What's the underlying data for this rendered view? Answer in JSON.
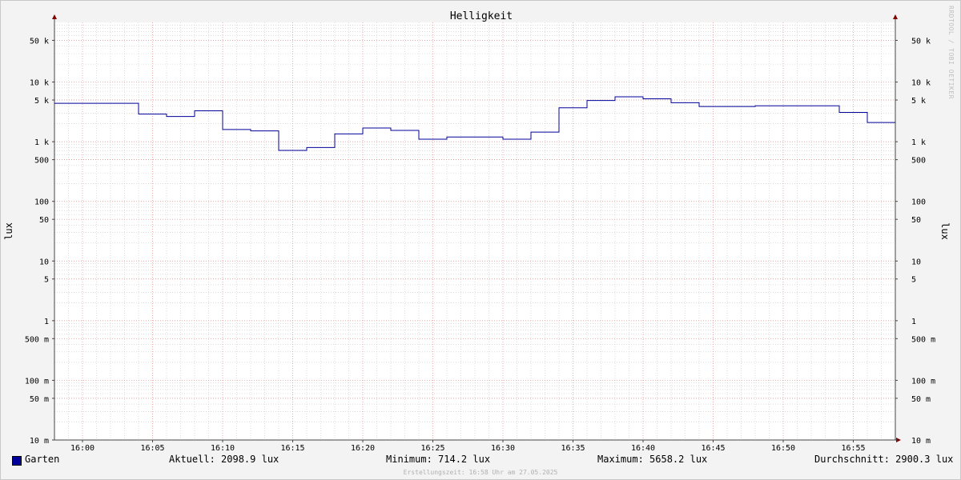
{
  "chart_data": {
    "type": "line",
    "line_style": "step",
    "title": "Helligkeit",
    "ylabel": "lux",
    "y_scale": "log",
    "ylim": [
      0.01,
      100000
    ],
    "y_ticks": [
      {
        "value": 0.01,
        "label": "10 m"
      },
      {
        "value": 0.05,
        "label": "50 m"
      },
      {
        "value": 0.1,
        "label": "100 m"
      },
      {
        "value": 0.5,
        "label": "500 m"
      },
      {
        "value": 1,
        "label": "1"
      },
      {
        "value": 5,
        "label": "5"
      },
      {
        "value": 10,
        "label": "10"
      },
      {
        "value": 50,
        "label": "50"
      },
      {
        "value": 100,
        "label": "100"
      },
      {
        "value": 500,
        "label": "500"
      },
      {
        "value": 1000,
        "label": "1 k"
      },
      {
        "value": 5000,
        "label": "5 k"
      },
      {
        "value": 10000,
        "label": "10 k"
      },
      {
        "value": 50000,
        "label": "50 k"
      }
    ],
    "xlim": [
      "15:58",
      "16:58"
    ],
    "x_ticks": [
      "16:00",
      "16:05",
      "16:10",
      "16:15",
      "16:20",
      "16:25",
      "16:30",
      "16:35",
      "16:40",
      "16:45",
      "16:50",
      "16:55"
    ],
    "grid": true,
    "series": [
      {
        "name": "Garten",
        "color": "#000099",
        "x": [
          "15:58",
          "16:04",
          "16:06",
          "16:08",
          "16:10",
          "16:12",
          "16:14",
          "16:16",
          "16:18",
          "16:20",
          "16:22",
          "16:24",
          "16:26",
          "16:28",
          "16:30",
          "16:32",
          "16:34",
          "16:36",
          "16:38",
          "16:40",
          "16:42",
          "16:44",
          "16:46",
          "16:48",
          "16:50",
          "16:52",
          "16:54",
          "16:56",
          "16:58"
        ],
        "y": [
          4400,
          2900,
          2650,
          3300,
          1600,
          1520,
          714.2,
          800,
          1350,
          1700,
          1550,
          1100,
          1200,
          1200,
          1100,
          1450,
          3700,
          4900,
          5658.2,
          5250,
          4500,
          3900,
          3900,
          4000,
          4000,
          4000,
          3100,
          2098.9,
          2098.9
        ]
      }
    ],
    "legend": {
      "position": "bottom",
      "series_label": "Garten",
      "current": "Aktuell: 2098.9 lux",
      "minimum": "Minimum: 714.2 lux",
      "maximum": "Maximum: 5658.2 lux",
      "average": "Durchschnitt: 2900.3 lux"
    },
    "footer": "Erstellungszeit: 16:58 Uhr am 27.05.2025",
    "watermark": "RRDTOOL / TOBI OETIKER"
  },
  "colors": {
    "line": "#000099",
    "major_grid": "#e08b8b",
    "minor_grid": "#c8c8c8",
    "arrow": "#800000",
    "background": "#f3f3f3",
    "plot_background": "#ffffff"
  }
}
